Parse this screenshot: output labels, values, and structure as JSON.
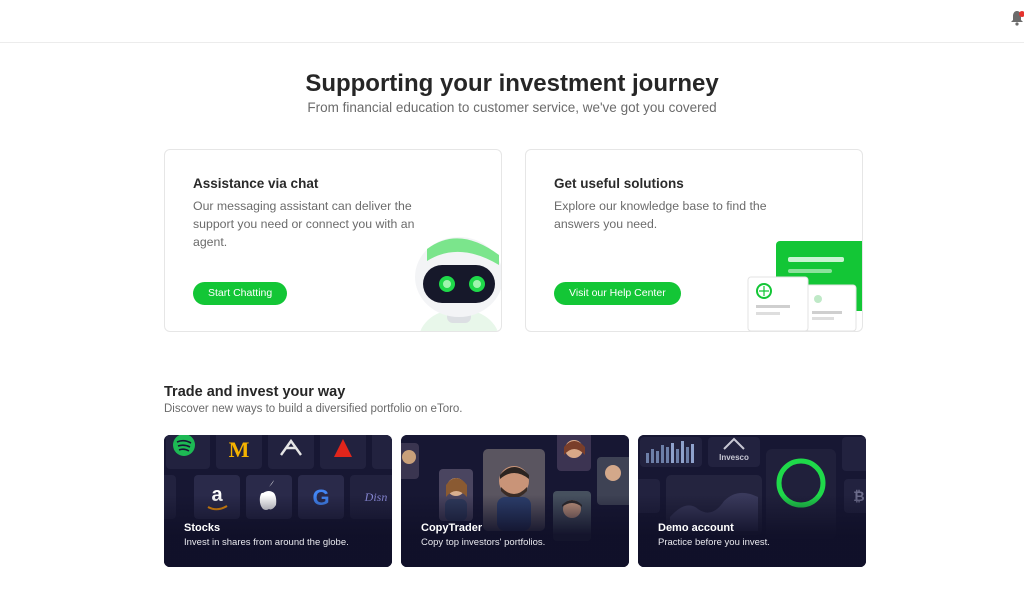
{
  "header": {
    "icon": "bell-icon",
    "notification_color": "#e5322d"
  },
  "hero": {
    "title": "Supporting your investment journey",
    "subtitle": "From financial education to customer service, we've got you covered"
  },
  "support_cards": [
    {
      "title": "Assistance via chat",
      "description": "Our messaging assistant can deliver the support you need or connect you with an agent.",
      "button_label": "Start Chatting",
      "illustration": "robot-icon"
    },
    {
      "title": "Get useful solutions",
      "description": "Explore our knowledge base to find the answers you need.",
      "button_label": "Visit our Help Center",
      "illustration": "knowledge-base-icon"
    }
  ],
  "trade_section": {
    "title": "Trade and invest your way",
    "subtitle": "Discover new ways to build a diversified portfolio on eToro.",
    "cards": [
      {
        "name": "Stocks",
        "description": "Invest in shares from around the globe."
      },
      {
        "name": "CopyTrader",
        "description": "Copy top investors' portfolios."
      },
      {
        "name": "Demo account",
        "description": "Practice before you invest."
      }
    ]
  },
  "colors": {
    "accent": "#13c636",
    "card_dark": "#14142e",
    "text_muted": "#6b6b6b"
  }
}
